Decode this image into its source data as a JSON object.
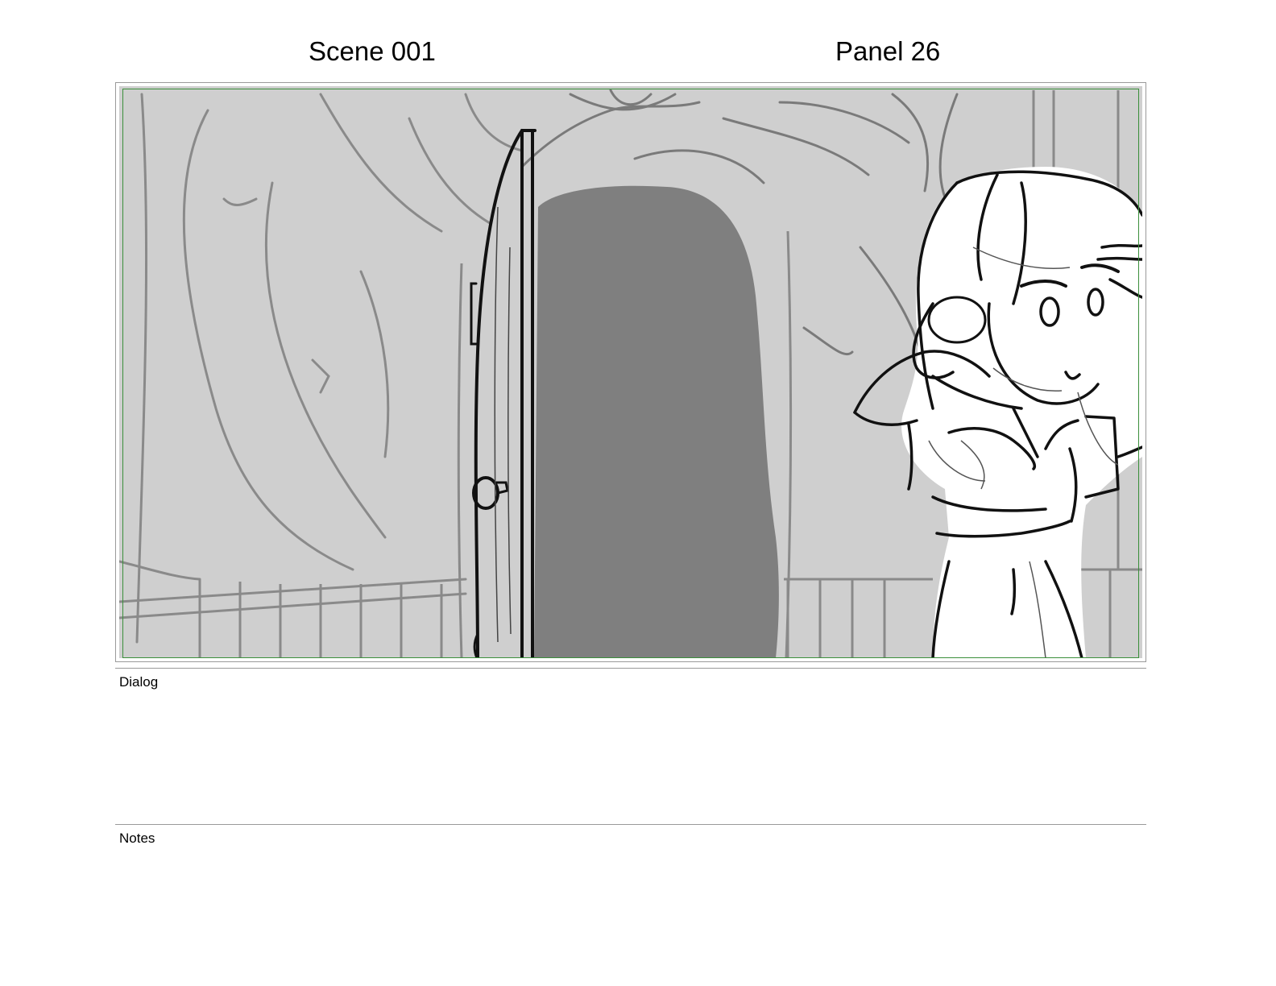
{
  "header": {
    "scene": "Scene 001",
    "panel": "Panel 26"
  },
  "panel_image": {
    "description_icon": "storyboard-sketch-image"
  },
  "dialog": {
    "label": "Dialog",
    "text": ""
  },
  "notes": {
    "label": "Notes",
    "text": ""
  },
  "colors": {
    "safe_area_border": "#3b8f3b",
    "frame_border": "#9a9a9a",
    "background_tone": "#cfcfcf",
    "doorway_fill": "#7f7f7f"
  }
}
